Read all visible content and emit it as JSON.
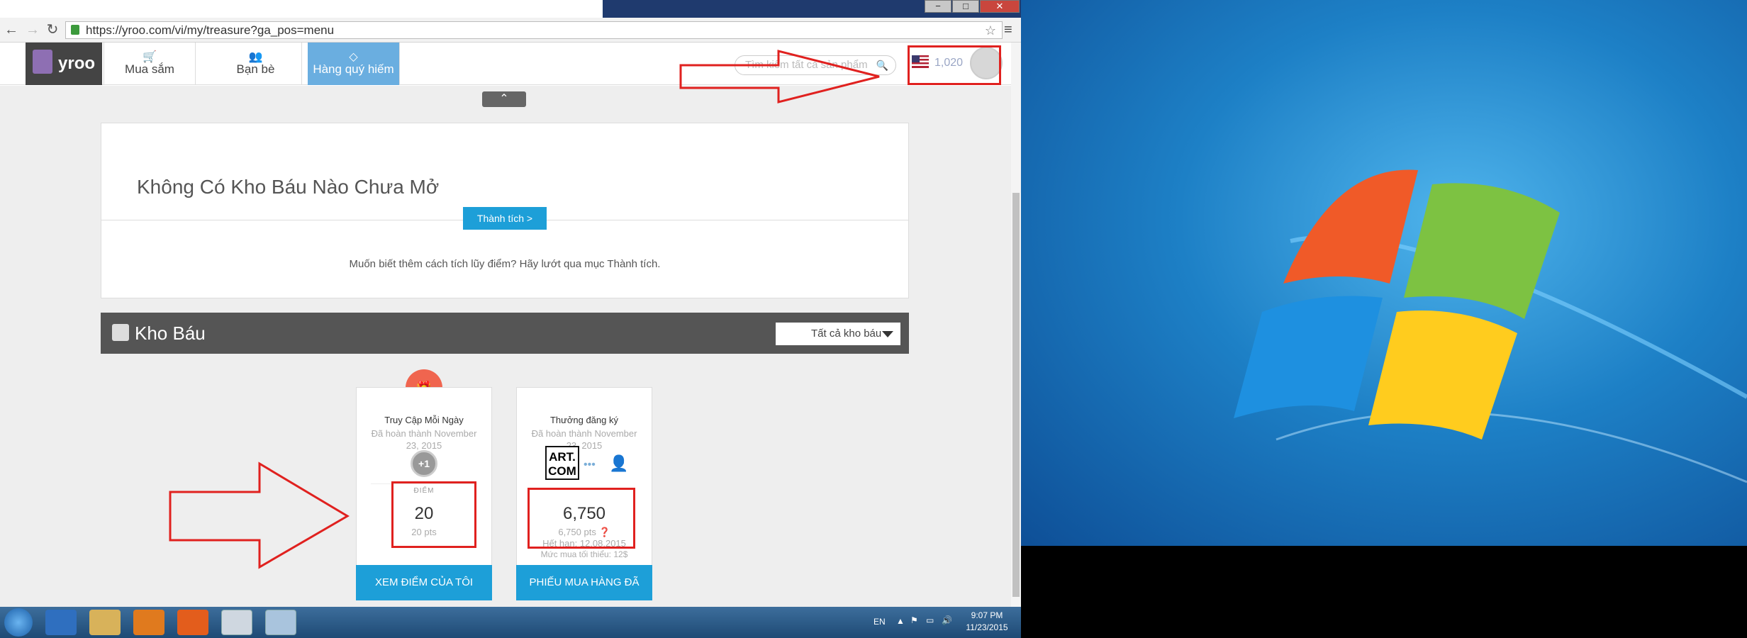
{
  "browser": {
    "url": "https://yroo.com/vi/my/treasure?ga_pos=menu",
    "window_buttons": [
      "−",
      "□",
      "✕"
    ]
  },
  "site": {
    "logo": "yroo",
    "nav": [
      {
        "label": "Mua sắm",
        "icon": "cart-icon"
      },
      {
        "label": "Bạn bè",
        "icon": "friends-icon"
      },
      {
        "label": "Hàng quý hiếm",
        "icon": "diamond-icon"
      }
    ],
    "search_placeholder": "Tìm kiếm tất cả sản phẩm",
    "points": "1,020"
  },
  "treasure_panel": {
    "title": "Không Có Kho Báu Nào Chưa Mở",
    "button": "Thành tích  >",
    "hint": "Muốn biết thêm cách tích lũy điểm? Hãy lướt qua mục Thành tích."
  },
  "kho_bau": {
    "title": "Kho Báu",
    "filter": "Tất cả kho báu"
  },
  "cards": [
    {
      "name": "Truy Cập Mỗi Ngày",
      "done": "Đã hoàn thành November 23, 2015",
      "badge": "+1",
      "label": "ĐIỂM",
      "big": "20",
      "small": "20 pts",
      "cta": "XEM ĐIỂM CỦA TÔI"
    },
    {
      "name": "Thưởng đăng ký",
      "done": "Đã hoàn thành November 23, 2015",
      "logo": "ART. COM",
      "big": "6,750",
      "small": "6,750 pts",
      "expiry": "Hết hạn: 12.08.2015",
      "minimum": "Mức mua tối thiểu: 12$",
      "cta": "PHIẾU MUA HÀNG ĐÃ TẶNG"
    }
  ],
  "taskbar": {
    "language": "EN",
    "time": "9:07 PM",
    "date": "11/23/2015"
  },
  "colors": {
    "accent": "#1d9fd8",
    "annotation": "#e0211f",
    "nav_active": "#6aaee0"
  }
}
